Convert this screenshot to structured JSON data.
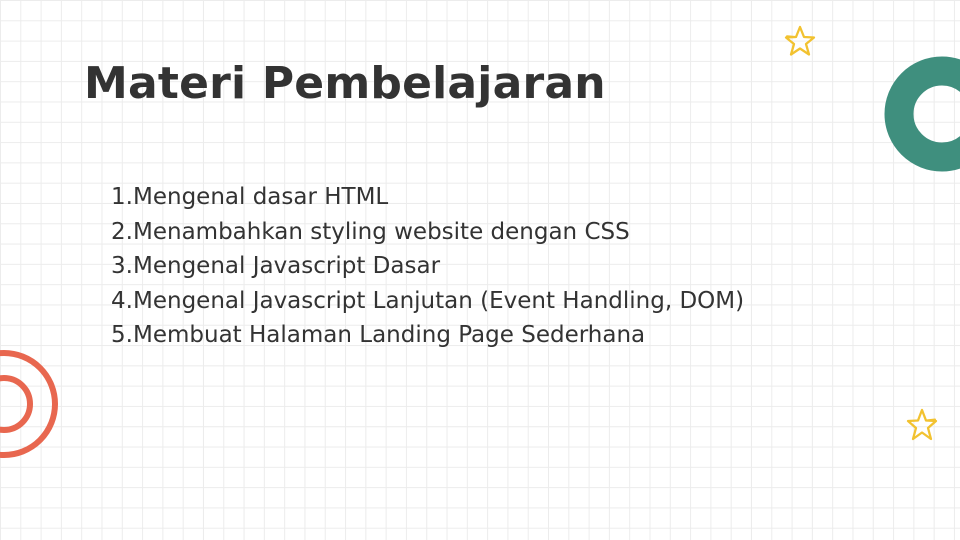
{
  "slide": {
    "title": "Materi Pembelajaran",
    "items": [
      {
        "number": "1.",
        "text": "Mengenal dasar HTML"
      },
      {
        "number": "2.",
        "text": "Menambahkan styling website dengan CSS"
      },
      {
        "number": "3.",
        "text": "Mengenal Javascript Dasar"
      },
      {
        "number": "4.",
        "text": "Mengenal Javascript Lanjutan (Event Handling, DOM)"
      },
      {
        "number": "5.",
        "text": "Membuat Halaman Landing Page Sederhana"
      }
    ]
  },
  "colors": {
    "text": "#333333",
    "teal_ring": "#3f8f7e",
    "coral_ring": "#e8674f",
    "star": "#f2c230"
  },
  "icons": {
    "top_star": "star-outline-icon",
    "bottom_star": "star-outline-icon",
    "teal_ring": "ring-shape",
    "coral_rings": "concentric-ring-shape"
  }
}
